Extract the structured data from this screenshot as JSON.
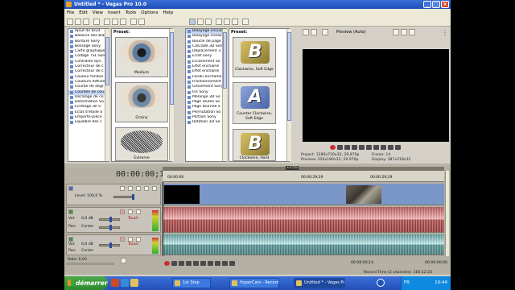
{
  "window": {
    "title": "Untitled * - Vegas Pro 10.0",
    "min": "_",
    "max": "□",
    "close": "×"
  },
  "menu": [
    "File",
    "Edit",
    "View",
    "Insert",
    "Tools",
    "Options",
    "Help"
  ],
  "fx_list": {
    "items": [
      "Ajout de bruit",
      "Balance des blan",
      "Bordure Sony",
      "Bossage Sony",
      "Carte graphique",
      "Codage TSL Sony",
      "Contraste dyn.",
      "Correcteur de c",
      "Correcteur de c",
      "Couleur fondue",
      "Couleurs diffuses",
      "Courbe de degr",
      "Courbes de cou",
      "Décalage de co",
      "Déformation So",
      "Écrêtage de S",
      "Éclat d'étoile S",
      "Emporte-pièce",
      "Équilibre des c"
    ],
    "selected": 12
  },
  "fx_presets": {
    "header": "Preset:",
    "items": [
      "Medium",
      "Grainy",
      "Extreme"
    ]
  },
  "transition_list": {
    "items": [
      "Balayage circula",
      "Balayage linéaire",
      "Boucle de page",
      "Cascade 3D Son",
      "Déplacement 3",
      "Éclat Sony",
      "Écrasement So",
      "Effet enchaîné",
      "Effet enchaîné",
      "Fondu enchaîné",
      "Fractionnement",
      "Glissement Sony",
      "Iris Sony",
      "Mélange 3D So",
      "Page roulée So",
      "Page tournée S",
      "Permutation So",
      "Portails Sony",
      "Rotation 3D So"
    ],
    "selected": 0
  },
  "transition_presets": {
    "header": "Preset:",
    "items": [
      "Clockwise, Soft Edge",
      "Counter Clockwise, Soft Edge",
      "Clockwise, Hard"
    ],
    "letters": [
      "B",
      "A",
      "B"
    ]
  },
  "preview": {
    "mode": "Preview (Auto)",
    "project_label": "Project:",
    "project": "1280x720x32; 29,970p",
    "preview_label": "Preview:",
    "preview_value": "320x180x32; 29,970p",
    "frame_label": "Frame:",
    "frame": "14",
    "display_label": "Display:",
    "display": "387x218x32"
  },
  "timeline": {
    "timecode": "00:00:00;14",
    "marker": "+1:55",
    "ruler": [
      "00:00:00",
      "00:00:29;29",
      "00:00:29;29"
    ]
  },
  "tracks": {
    "video": {
      "level": "Level: 100,0 %"
    },
    "audio1": {
      "vol": "Vol:",
      "vol_value": "0,0 dB",
      "pan": "Pan:",
      "pan_value": "Center",
      "mode": "Touch"
    },
    "audio2": {
      "vol": "Vol:",
      "vol_value": "0,0 dB",
      "pan": "Pan:",
      "pan_value": "Center",
      "mode": "Touch"
    }
  },
  "bottom": {
    "rate": "Rate: 0,00",
    "timecode": "00:00:00;14",
    "end_timecode": "00:00:00;00",
    "record_time": "Record Time (2 channels): 164:12:25"
  },
  "taskbar": {
    "start": "démarrer",
    "items": [
      "1st Step",
      "HyperCam - Recording",
      "Untitled * - Vegas Pro..."
    ],
    "lang": "FR",
    "clock": "10:44"
  }
}
